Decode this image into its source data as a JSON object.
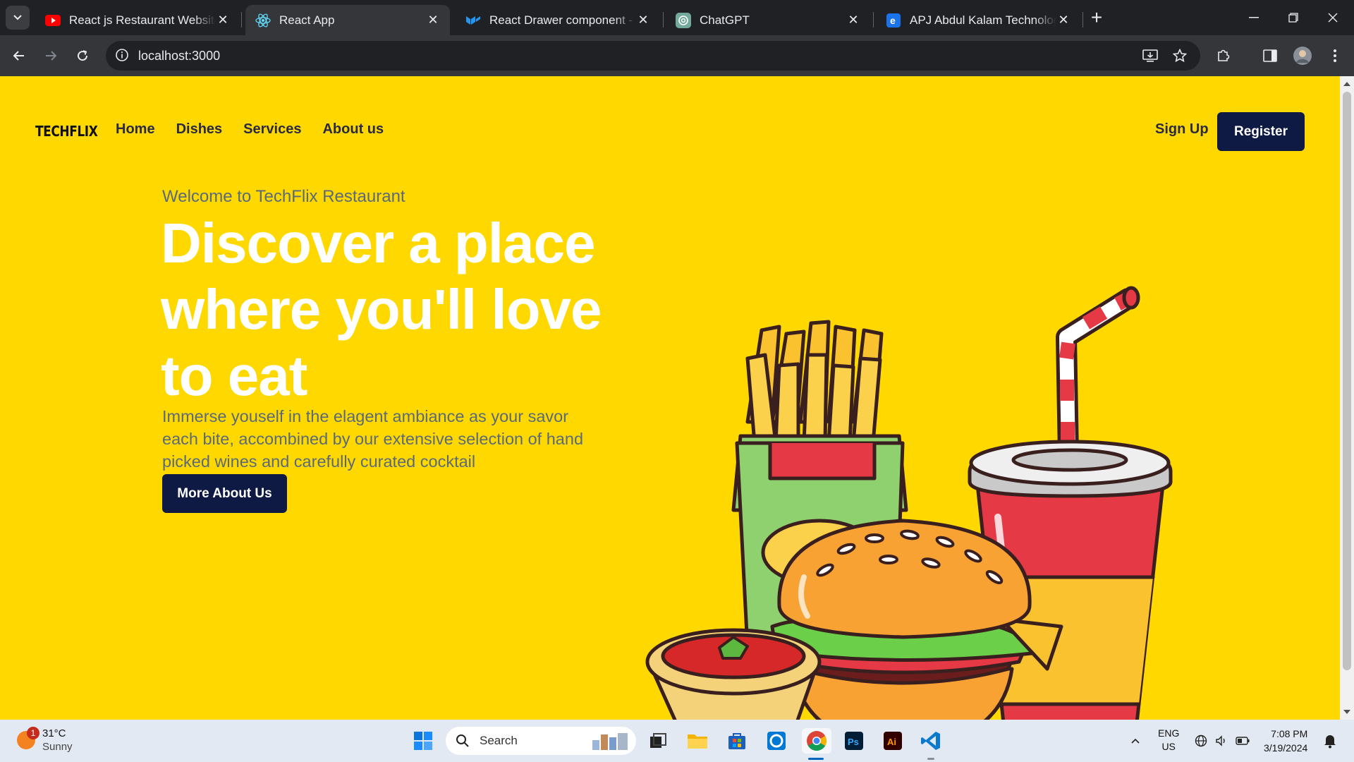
{
  "browser": {
    "tabs": [
      {
        "title": "React js Restaurant Website with",
        "favicon": "youtube-icon",
        "active": false
      },
      {
        "title": "React App",
        "favicon": "react-icon",
        "active": true
      },
      {
        "title": "React Drawer component - Mat",
        "favicon": "mui-icon",
        "active": false
      },
      {
        "title": "ChatGPT",
        "favicon": "chatgpt-icon",
        "active": false
      },
      {
        "title": "APJ Abdul Kalam Technological",
        "favicon": "edge-e-icon",
        "active": false
      }
    ],
    "address": "localhost:3000"
  },
  "site": {
    "logo": "TECHFLIX",
    "nav": [
      "Home",
      "Dishes",
      "Services",
      "About us"
    ],
    "signup_label": "Sign Up",
    "register_label": "Register",
    "welcome": "Welcome to TechFlix Restaurant",
    "headline": "Discover a place where you'll love to eat",
    "description": "Immerse youself in the elagent ambiance as your savor each bite, accombined by our extensive selection of hand picked wines and carefully curated cocktail",
    "cta_label": "More About Us",
    "colors": {
      "background": "#ffd800",
      "primary": "#0f1a44",
      "muted_text": "#5a6a7a"
    }
  },
  "taskbar": {
    "weather_temp": "31°C",
    "weather_desc": "Sunny",
    "weather_badge": "1",
    "search_label": "Search",
    "lang_top": "ENG",
    "lang_bottom": "US",
    "time": "7:08 PM",
    "date": "3/19/2024"
  }
}
